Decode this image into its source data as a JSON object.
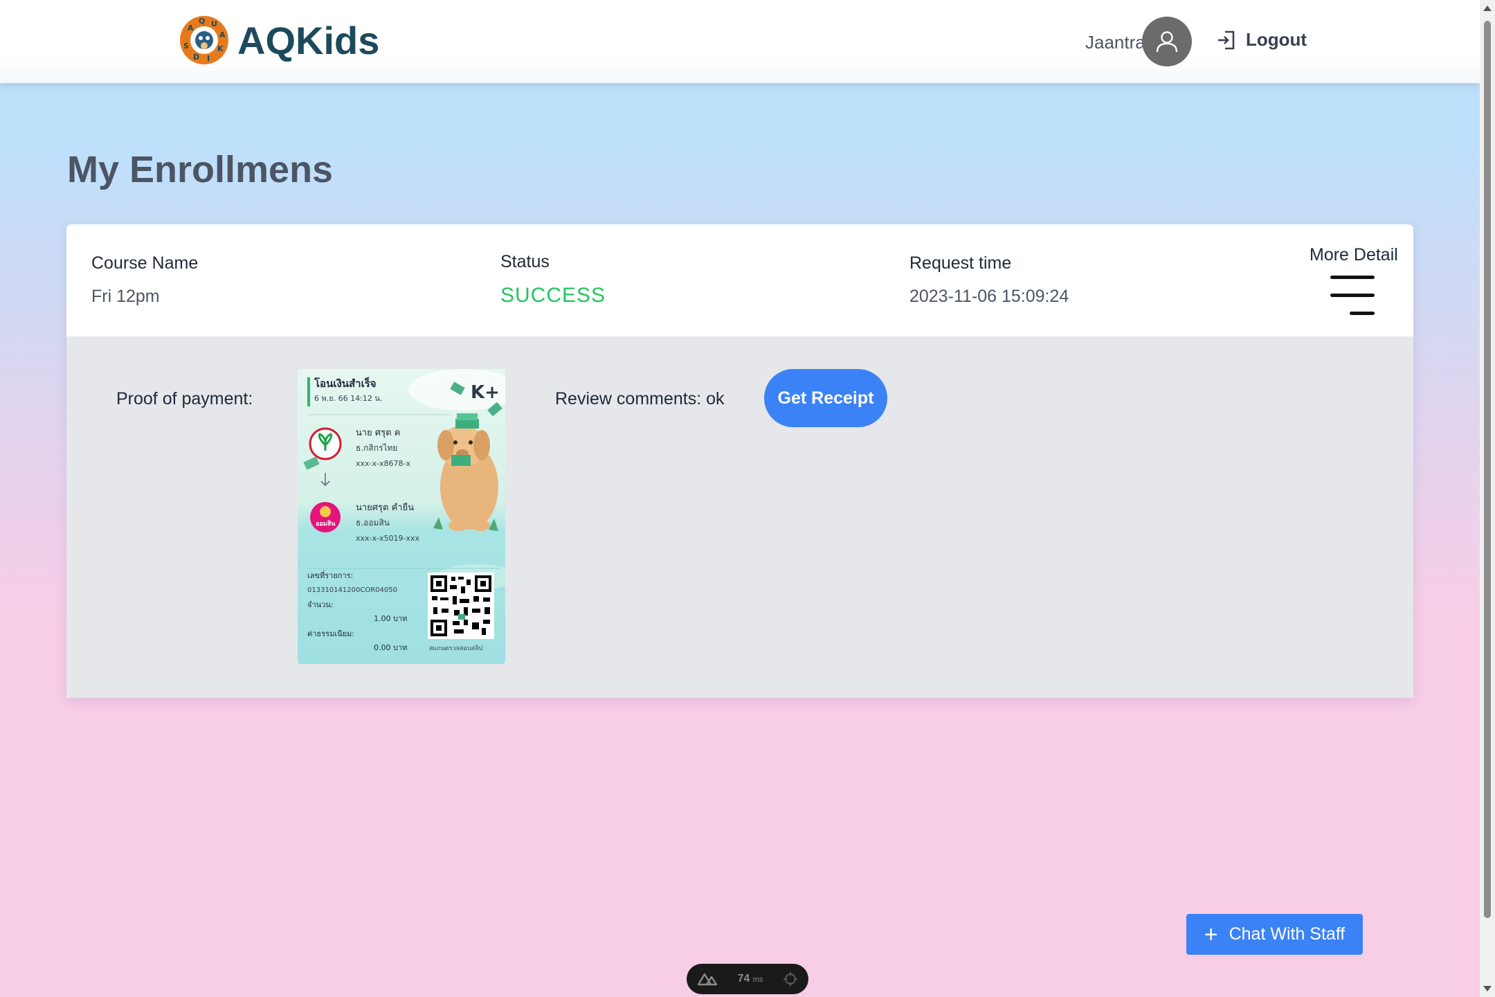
{
  "header": {
    "brand_name": "AQKids",
    "logo_letters": "AQUAKIDS",
    "user_name": "Jaantra",
    "logout_label": "Logout"
  },
  "page": {
    "title": "My Enrollmens"
  },
  "enrollment": {
    "course_label": "Course Name",
    "course_value": "Fri 12pm",
    "status_label": "Status",
    "status_value": "SUCCESS",
    "request_label": "Request time",
    "request_value": "2023-11-06 15:09:24",
    "more_label": "More Detail",
    "proof_label": "Proof of payment:",
    "review_label": "Review comments: ok",
    "receipt_label": "Get Receipt"
  },
  "slip": {
    "title": "โอนเงินสำเร็จ",
    "datetime": "6 พ.ย. 66  14:12 น.",
    "brand": "K+",
    "from_name": "นาย ศรุต ค",
    "from_bank": "ธ.กสิกรไทย",
    "from_account": "xxx-x-x8678-x",
    "to_name": "นายศรุต คำยืน",
    "to_bank": "ธ.ออมสิน",
    "to_account": "xxx-x-x5019-xxx",
    "ref_label": "เลขที่รายการ:",
    "ref_value": "013310141200COR04050",
    "amount_label": "จำนวน:",
    "amount_value": "1.00 บาท",
    "fee_label": "ค่าธรรมเนียม:",
    "fee_value": "0.00 บาท",
    "qr_caption": "สแกนตรวจสอบสลิป",
    "gsb_badge": "ออมสิน"
  },
  "chat": {
    "label": "Chat With Staff"
  },
  "devtools": {
    "ms_value": "74",
    "ms_unit": "ms"
  },
  "colors": {
    "accent": "#3b82f6",
    "success": "#22c55e",
    "brand": "#1c4a5c"
  }
}
